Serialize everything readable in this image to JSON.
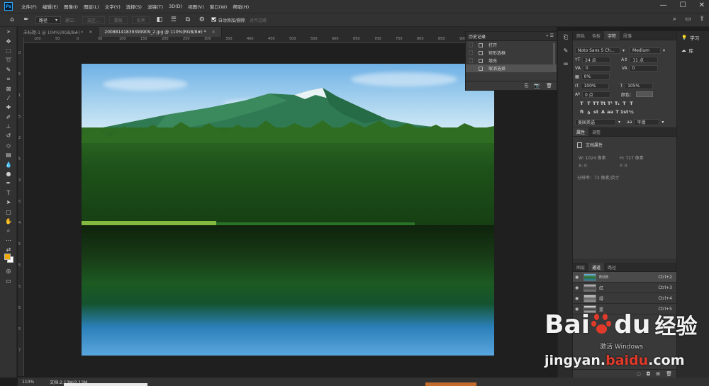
{
  "menubar": {
    "logo": "Ps",
    "items": [
      "文件(F)",
      "编辑(E)",
      "图像(I)",
      "图层(L)",
      "文字(Y)",
      "选择(S)",
      "滤镜(T)",
      "3D(D)",
      "视图(V)",
      "窗口(W)",
      "帮助(H)"
    ],
    "controls": [
      "—",
      "☐",
      "✕"
    ]
  },
  "options": {
    "mode_value": "路径",
    "build_label": "建立：",
    "selection_label": "选区...",
    "mask_label": "蒙版",
    "shape_label": "形状",
    "auto_add_label": "自动添加/删除",
    "align_edges_label": "对齐边缘"
  },
  "tabs": [
    {
      "label": "未标题-1 @ 104%(RGB/8#) *",
      "active": false
    },
    {
      "label": "20088141839399909_2.jpg @ 110%(RGB/8#) *",
      "active": true
    }
  ],
  "ruler": {
    "h": [
      "100",
      "50",
      "0",
      "50",
      "100",
      "150",
      "200",
      "250",
      "300",
      "350",
      "400",
      "450",
      "500",
      "550",
      "600",
      "650",
      "700",
      "750",
      "800",
      "850",
      "900",
      "950",
      "1000",
      "1050",
      "1100"
    ],
    "v": [
      "0",
      "5",
      "1",
      "5",
      "2",
      "5",
      "3",
      "5",
      "4",
      "5",
      "5",
      "5",
      "6",
      "5",
      "7"
    ]
  },
  "history": {
    "title": "历史记录",
    "items": [
      {
        "label": "打开",
        "active": false
      },
      {
        "label": "矩形选框",
        "active": false
      },
      {
        "label": "填充",
        "active": false
      },
      {
        "label": "取消选择",
        "active": true
      }
    ]
  },
  "character": {
    "tabs": [
      "颜色",
      "色板",
      "字符",
      "段落"
    ],
    "active_tab": "字符",
    "font_family": "Noto Sans S Ch...",
    "font_style": "Medium",
    "font_size": "24 点",
    "leading": "11 点",
    "kerning": "0",
    "tracking": "0",
    "scale_percent": "0%",
    "vscale": "100%",
    "hscale": "105%",
    "baseline": "0 点",
    "color_label": "颜色：",
    "format_buttons": [
      "T",
      "T",
      "TT",
      "Tt",
      "T¹",
      "T₁",
      "T",
      "T"
    ],
    "opentype_buttons": [
      "fi",
      "ꝺ",
      "st",
      "A",
      "aa",
      "T",
      "1st",
      "½"
    ],
    "language": "美国英语",
    "aa_label": "aa",
    "aa_mode": "平滑"
  },
  "properties": {
    "tabs": [
      "属性",
      "调整"
    ],
    "active_tab": "属性",
    "doc_label": "文档属性",
    "w": "W:  1024 像素",
    "h": "H:  727 像素",
    "x": "X:  0",
    "y": "Y:  0",
    "resolution": "分辨率：72 像素/英寸"
  },
  "channels": {
    "tabs": [
      "图层",
      "通道",
      "路径"
    ],
    "active_tab": "通道",
    "rows": [
      {
        "name": "RGB",
        "shortcut": "Ctrl+2"
      },
      {
        "name": "红",
        "shortcut": "Ctrl+3"
      },
      {
        "name": "绿",
        "shortcut": "Ctrl+4"
      },
      {
        "name": "蓝",
        "shortcut": "Ctrl+5"
      }
    ]
  },
  "learn": {
    "learn_label": "学习",
    "library_label": "库"
  },
  "status": {
    "zoom": "110%",
    "doc_size": "文档:2.13M/2.13M"
  },
  "watermark": {
    "bai": "Bai",
    "du": "du",
    "cn": "经验",
    "sub": "激活 Windows",
    "url_prefix": "jingyan.",
    "url_brand": "baidu",
    "url_suffix": ".com"
  }
}
